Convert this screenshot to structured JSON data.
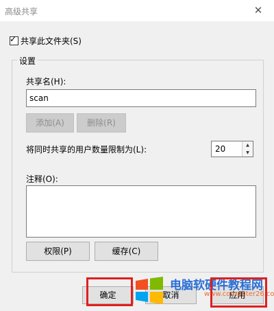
{
  "window": {
    "title": "高级共享",
    "close_glyph": "✕"
  },
  "share": {
    "checkbox_label": "共享此文件夹(S)",
    "checked": true,
    "check_glyph": "✓"
  },
  "settings": {
    "group_label": "设置",
    "share_name_label": "共享名(H):",
    "share_name_value": "scan",
    "add_button": "添加(A)",
    "delete_button": "删除(R)",
    "user_limit_label": "将同时共享的用户数量限制为(L):",
    "user_limit_value": "20",
    "comment_label": "注释(O):",
    "comment_value": "",
    "permissions_button": "权限(P)",
    "cache_button": "缓存(C)"
  },
  "footer": {
    "ok_button": "确定",
    "cancel_button": "取消",
    "apply_button": "应用"
  },
  "watermark": {
    "title": "电脑软硬件教程网",
    "url": "www.computer26.com"
  },
  "colors": {
    "highlight": "#e01f1f",
    "watermark_title": "#2b6fd6",
    "watermark_url": "#ef6a2a"
  }
}
